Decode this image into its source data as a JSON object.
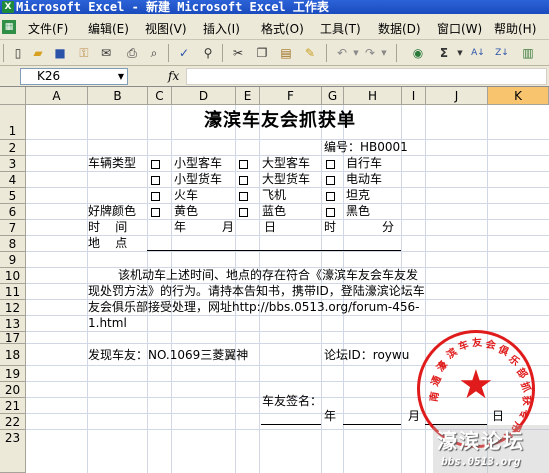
{
  "window": {
    "title": "Microsoft Excel - 新建 Microsoft Excel 工作表"
  },
  "menu": {
    "items": [
      "文件(F)",
      "编辑(E)",
      "视图(V)",
      "插入(I)",
      "格式(O)",
      "工具(T)",
      "数据(D)",
      "窗口(W)",
      "帮助(H)"
    ]
  },
  "toolbar": {
    "icons": [
      "new-icon",
      "open-icon",
      "save-icon",
      "permission-icon",
      "email-icon",
      "print-icon",
      "print-preview-icon",
      "spelling-icon",
      "research-icon",
      "cut-icon",
      "copy-icon",
      "paste-icon",
      "format-painter-icon",
      "undo-icon",
      "redo-icon",
      "hyperlink-icon",
      "autosum-icon",
      "sort-icon"
    ],
    "autosum_label": "Σ"
  },
  "formula_bar": {
    "name_box": "K26",
    "fx_label": "fx",
    "formula": ""
  },
  "grid": {
    "columns": [
      "A",
      "B",
      "C",
      "D",
      "E",
      "F",
      "G",
      "H",
      "I",
      "J",
      "K"
    ],
    "active_column": "K",
    "rows": [
      "1",
      "2",
      "3",
      "4",
      "5",
      "6",
      "7",
      "8",
      "9",
      "10",
      "11",
      "12",
      "13",
      "17",
      "18",
      "19",
      "20",
      "21",
      "22",
      "23"
    ]
  },
  "form": {
    "title": "濠滨车友会抓获单",
    "serial": "编号：HB0001",
    "vehicle_type_label": "车辆类型",
    "vehicle_types": [
      "小型客车",
      "大型客车",
      "自行车",
      "小型货车",
      "大型货车",
      "电动车",
      "火车",
      "飞机",
      "坦克"
    ],
    "color_label": "好牌颜色",
    "colors": [
      "黄色",
      "蓝色",
      "黑色"
    ],
    "time_label": "时    间",
    "time_units": [
      "年",
      "月",
      "日",
      "时",
      "分"
    ],
    "place_label": "地    点",
    "paragraph_lines": [
      "该机动车上述时间、地点的存在符合《濠滨车友会车友发",
      "现处罚方法》的行为。请持本告知书，携带ID，登陆濠滨论坛车",
      "友会俱乐部接受处理，网址http://bbs.0513.org/forum-456-",
      "1.html"
    ],
    "finder": "发现车友：NO.1069三菱翼神",
    "forum_id": "论坛ID：roywu",
    "signature_label": "车友签名：",
    "date_units": [
      "年",
      "月",
      "日"
    ]
  },
  "seal": {
    "text": "南通濠滨车友会俱乐部抓获专用章"
  },
  "watermark": {
    "title": "濠滨论坛",
    "url": "bbs.0513.org"
  },
  "colors": {
    "seal": "#e01b1b",
    "titlebar": "#2c63d8",
    "active_header": "#f9c46e"
  }
}
